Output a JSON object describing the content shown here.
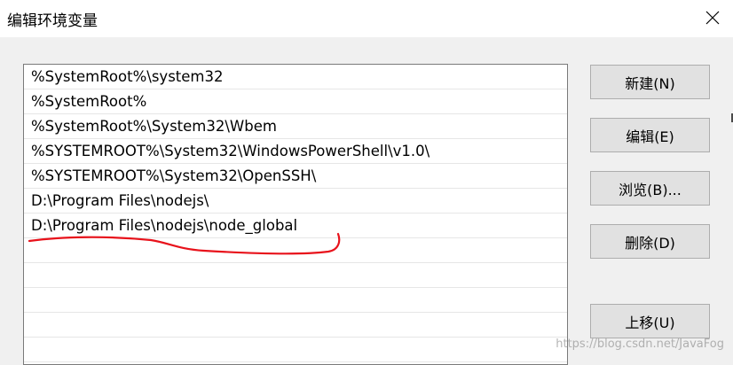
{
  "dialog": {
    "title": "编辑环境变量",
    "close_icon": "close-icon"
  },
  "path_list": {
    "entries": [
      "%SystemRoot%\\system32",
      "%SystemRoot%",
      "%SystemRoot%\\System32\\Wbem",
      "%SYSTEMROOT%\\System32\\WindowsPowerShell\\v1.0\\",
      "%SYSTEMROOT%\\System32\\OpenSSH\\",
      "D:\\Program Files\\nodejs\\",
      "D:\\Program Files\\nodejs\\node_global",
      "",
      "",
      "",
      "",
      ""
    ]
  },
  "buttons": {
    "new": "新建(N)",
    "edit": "编辑(E)",
    "browse": "浏览(B)...",
    "delete": "删除(D)",
    "move_up": "上移(U)"
  },
  "annotation": {
    "underline_color": "#e8121b"
  },
  "watermark": "https://blog.csdn.net/JavaFog"
}
